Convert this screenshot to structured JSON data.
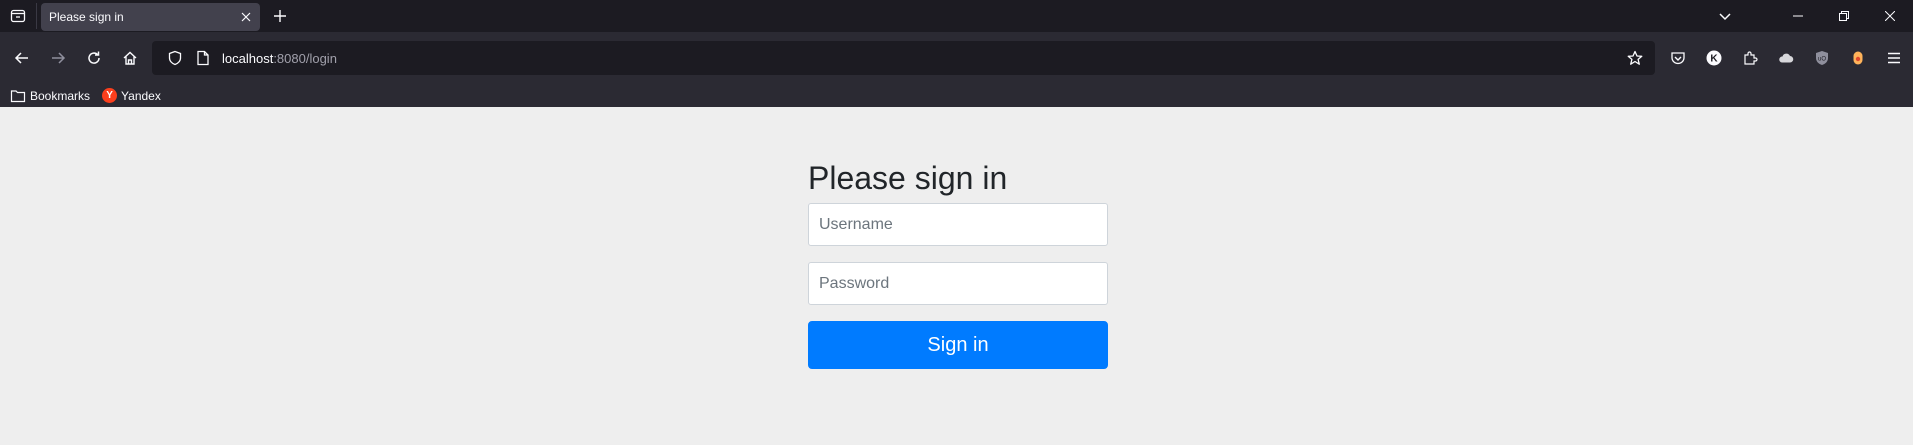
{
  "browser": {
    "tab": {
      "title": "Please sign in"
    },
    "url": {
      "host": "localhost",
      "rest": ":8080/login"
    },
    "bookmarks": [
      {
        "label": "Bookmarks",
        "icon": "folder-icon"
      },
      {
        "label": "Yandex",
        "icon": "yandex-icon",
        "badge": "Y"
      }
    ],
    "extensions": {
      "k_badge": "K"
    }
  },
  "form": {
    "heading": "Please sign in",
    "username_placeholder": "Username",
    "password_placeholder": "Password",
    "submit_label": "Sign in"
  },
  "colors": {
    "accent": "#007bff",
    "page_bg": "#eeeeee",
    "chrome_dark": "#1c1b22",
    "chrome_toolbar": "#2b2a33"
  }
}
